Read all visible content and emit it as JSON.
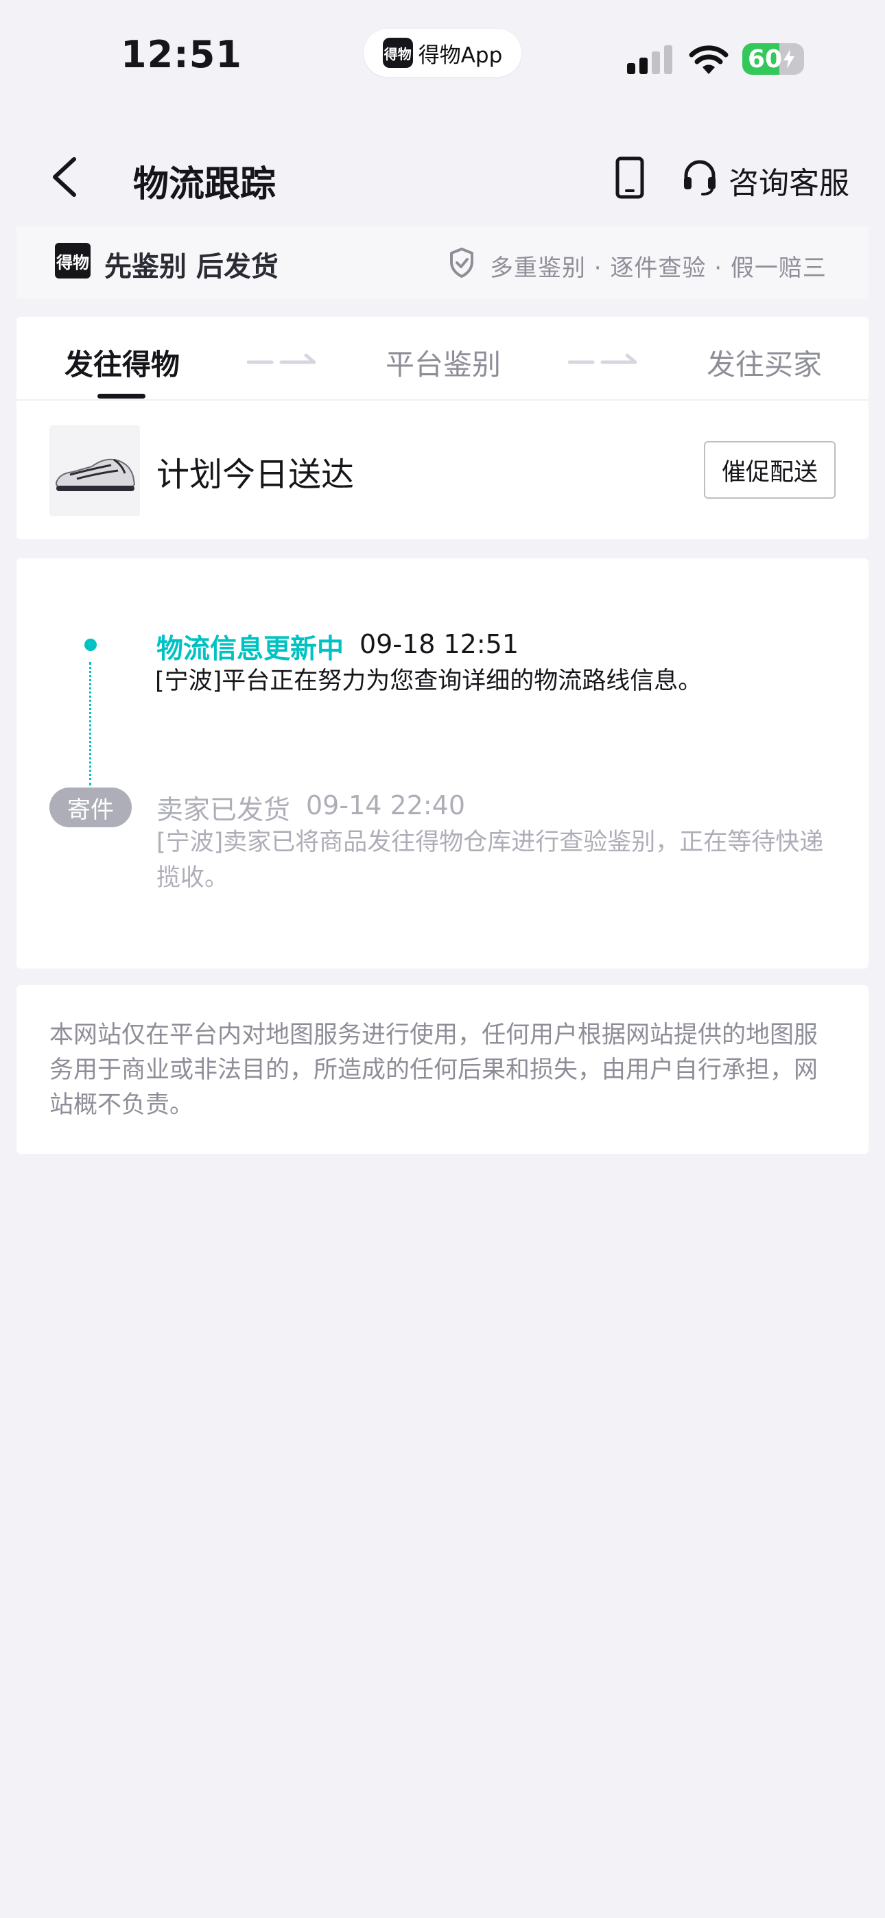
{
  "status_bar": {
    "time": "12:51",
    "island_app": "得物App",
    "island_logo_text": "得物",
    "battery": "60",
    "battery_level": 0.6,
    "signal_icon": "cellular-signal-icon",
    "wifi_icon": "wifi-icon"
  },
  "nav": {
    "back_icon": "back-chevron-icon",
    "title": "物流跟踪",
    "phone_icon": "phone-icon",
    "headset_icon": "headset-icon",
    "service_label": "咨询客服"
  },
  "banner": {
    "logo_text": "得物",
    "title": "先鉴别 后发货",
    "features": "多重鉴别 · 逐件查验 · 假一赔三"
  },
  "tabs": {
    "items": [
      "发往得物",
      "平台鉴别",
      "发往买家"
    ],
    "active_index": 0
  },
  "delivery": {
    "title": "计划今日送达",
    "urge_button": "催促配送"
  },
  "timeline": [
    {
      "status": "物流信息更新中",
      "time": "09-18 12:51",
      "description": "[宁波]平台正在努力为您查询详细的物流路线信息。",
      "active": true
    },
    {
      "badge": "寄件",
      "status": "卖家已发货",
      "time": "09-14 22:40",
      "description": "[宁波]卖家已将商品发往得物仓库进行查验鉴别，正在等待快递揽收。",
      "active": false
    }
  ],
  "disclaimer": "本网站仅在平台内对地图服务进行使用，任何用户根据网站提供的地图服务用于商业或非法目的，所造成的任何后果和损失，由用户自行承担，网站概不负责。",
  "colors": {
    "accent": "#01c2c3",
    "background": "#f2f2f7",
    "inactive": "#aeaeb8",
    "battery_green": "#34c759"
  }
}
